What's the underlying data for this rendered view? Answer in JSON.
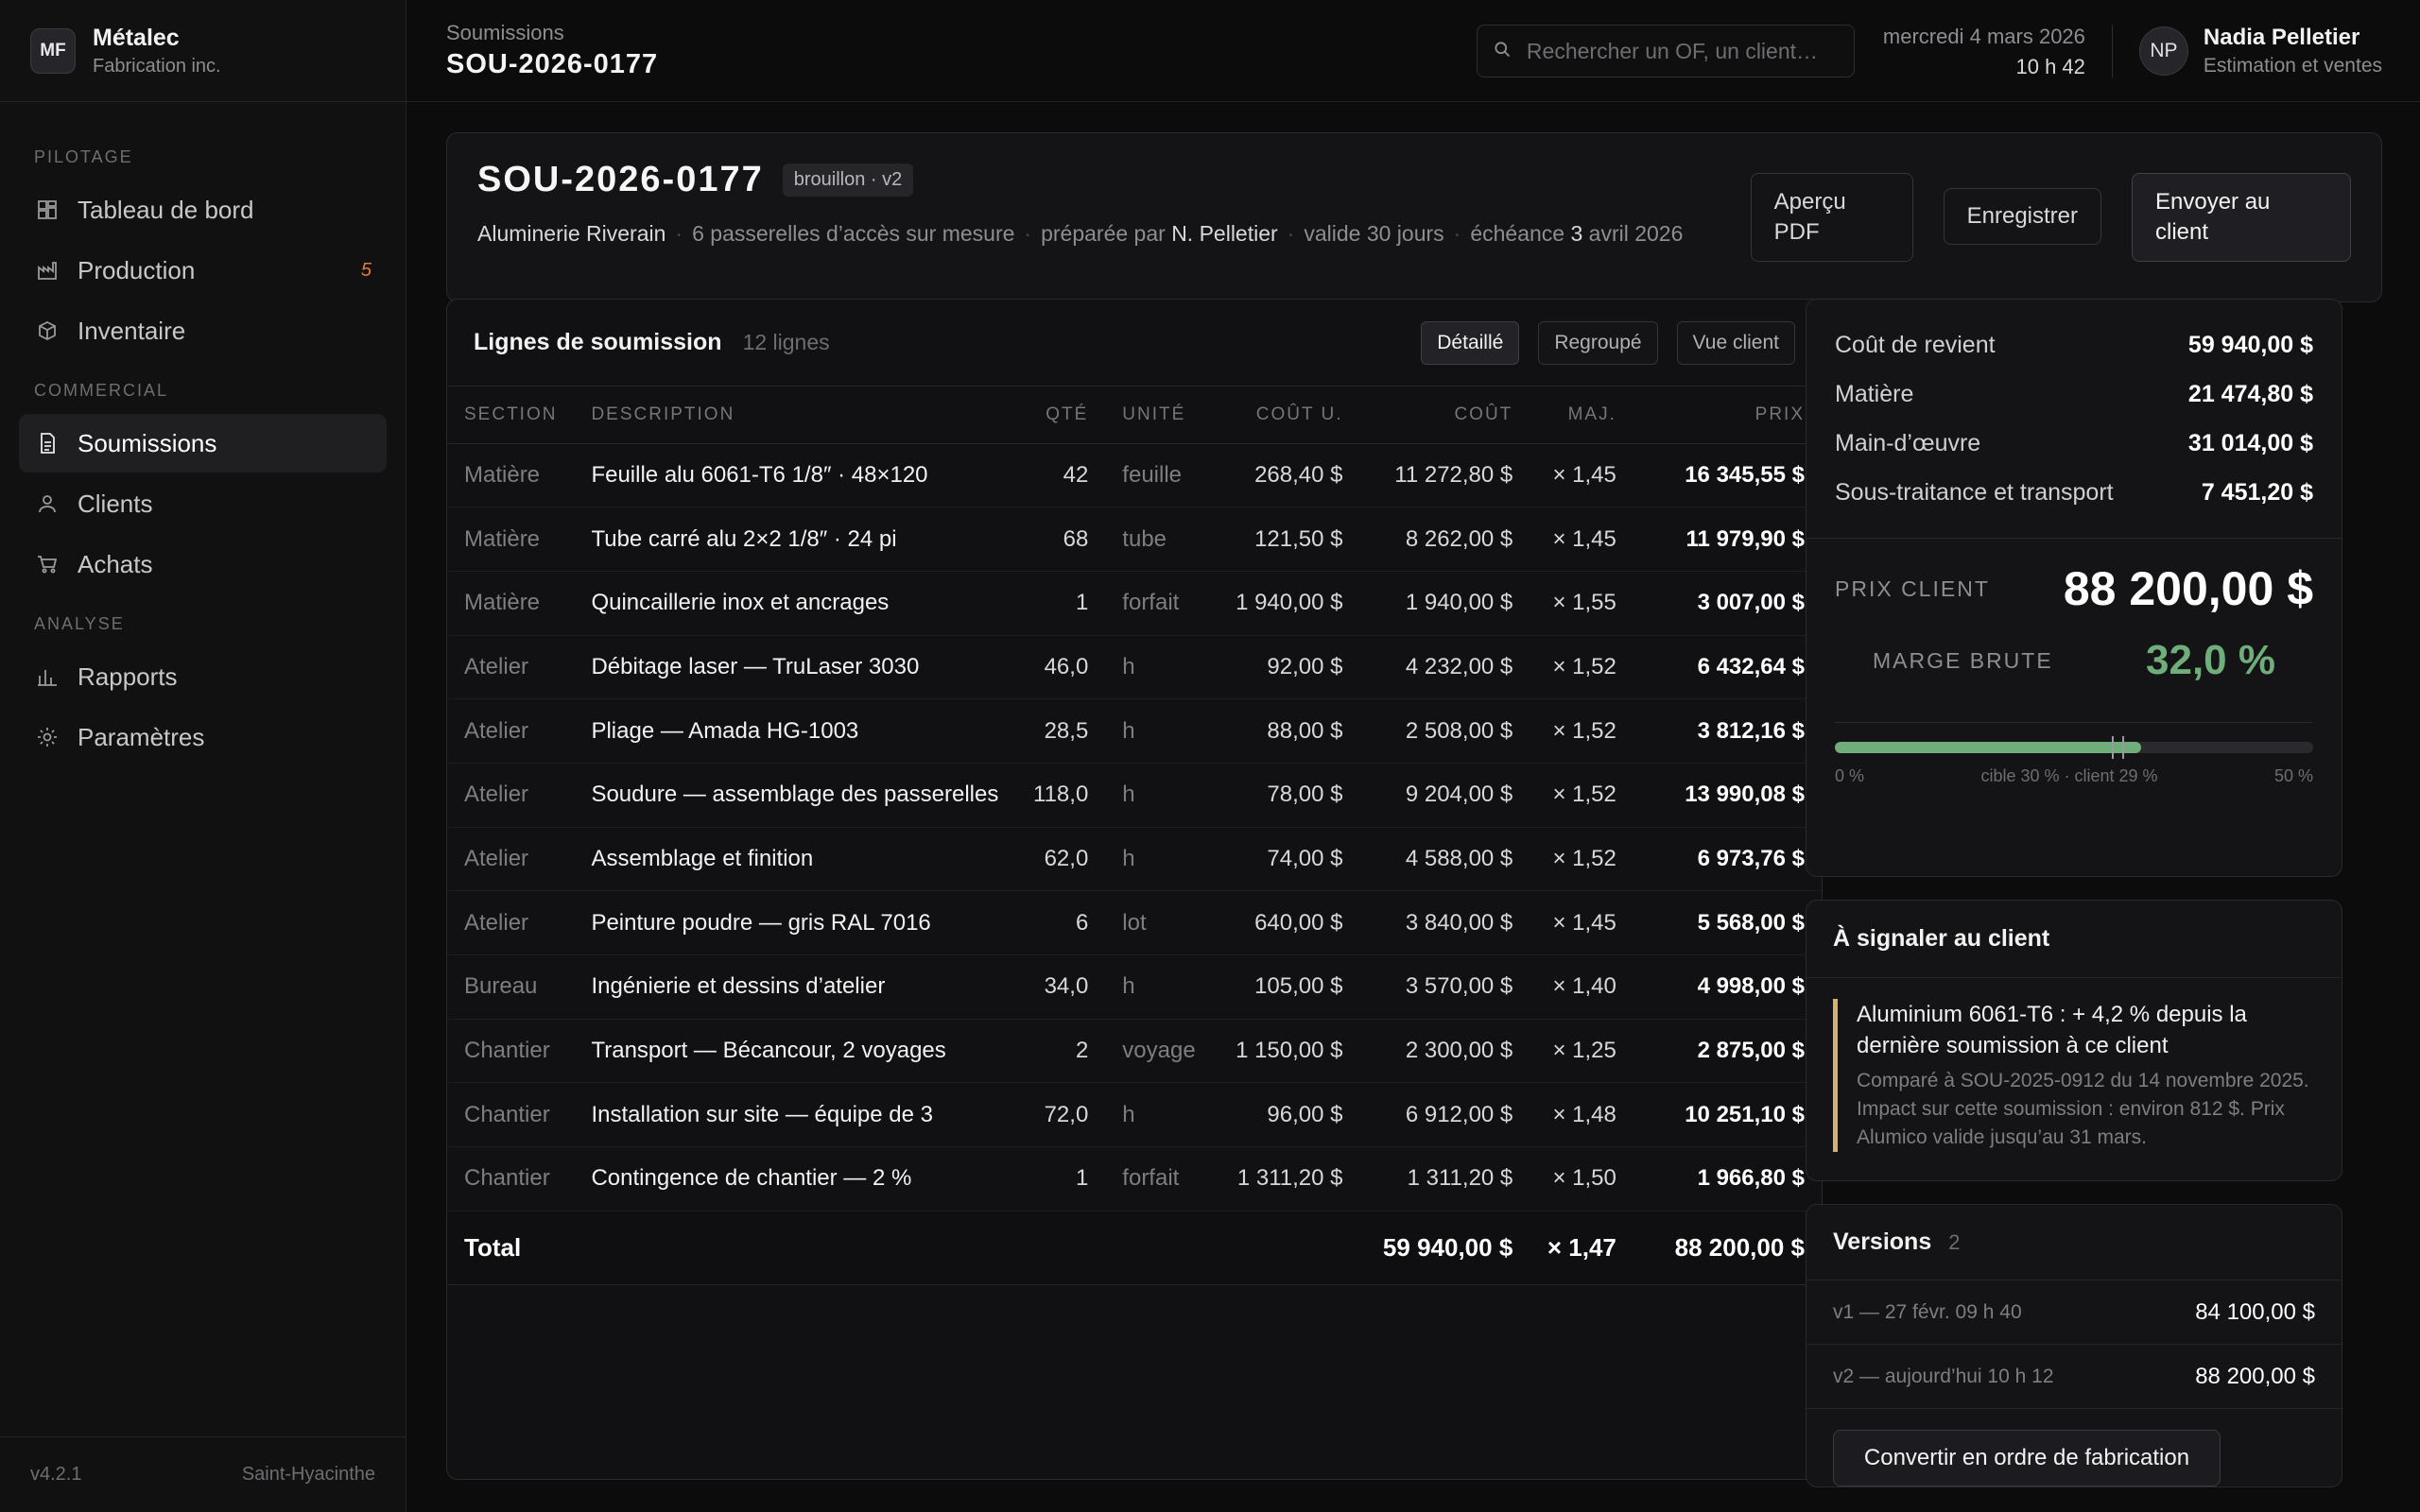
{
  "brand": {
    "initials": "MF",
    "name": "Métalec",
    "sub": "Fabrication inc."
  },
  "nav": {
    "sections": [
      {
        "title": "PILOTAGE",
        "items": [
          {
            "label": "Tableau de bord",
            "icon": "dashboard-icon"
          },
          {
            "label": "Production",
            "icon": "factory-icon",
            "badge": "5"
          },
          {
            "label": "Inventaire",
            "icon": "box-icon"
          }
        ]
      },
      {
        "title": "COMMERCIAL",
        "items": [
          {
            "label": "Soumissions",
            "icon": "document-icon",
            "active": true
          },
          {
            "label": "Clients",
            "icon": "user-icon"
          },
          {
            "label": "Achats",
            "icon": "cart-icon"
          }
        ]
      },
      {
        "title": "ANALYSE",
        "items": [
          {
            "label": "Rapports",
            "icon": "bar-chart-icon"
          },
          {
            "label": "Paramètres",
            "icon": "gear-icon"
          }
        ]
      }
    ],
    "version": "v4.2.1",
    "location": "Saint-Hyacinthe"
  },
  "topbar": {
    "crumb": "Soumissions",
    "title": "SOU-2026-0177",
    "search_placeholder": "Rechercher un OF, un client…",
    "date": "mercredi 4 mars 2026",
    "time": "10 h 42",
    "user_initials": "NP",
    "user_name": "Nadia Pelletier",
    "user_role": "Estimation et ventes"
  },
  "quote": {
    "id": "SOU-2026-0177",
    "status": "brouillon · v2",
    "client": "Aluminerie Riverain",
    "description": "6 passerelles d’accès sur mesure",
    "prepared_prefix": "préparée par",
    "prepared_by": "N. Pelletier",
    "validity": "valide 30 jours",
    "due_prefix": "échéance",
    "due_num": "3",
    "due_rest": "avril 2026",
    "btn_preview": "Aperçu PDF",
    "btn_save": "Enregistrer",
    "btn_send": "Envoyer au client"
  },
  "lines": {
    "title": "Lignes de soumission",
    "count": "12 lignes",
    "views": [
      "Détaillé",
      "Regroupé",
      "Vue client"
    ],
    "headers": [
      "SECTION",
      "DESCRIPTION",
      "QTÉ",
      "UNITÉ",
      "COÛT U.",
      "COÛT",
      "MAJ.",
      "PRIX"
    ],
    "rows": [
      [
        "Matière",
        "Feuille alu 6061-T6 1/8″ · 48×120",
        "42",
        "feuille",
        "268,40 $",
        "11 272,80 $",
        "× 1,45",
        "16 345,55 $"
      ],
      [
        "Matière",
        "Tube carré alu 2×2 1/8″ · 24 pi",
        "68",
        "tube",
        "121,50 $",
        "8 262,00 $",
        "× 1,45",
        "11 979,90 $"
      ],
      [
        "Matière",
        "Quincaillerie inox et ancrages",
        "1",
        "forfait",
        "1 940,00 $",
        "1 940,00 $",
        "× 1,55",
        "3 007,00 $"
      ],
      [
        "Atelier",
        "Débitage laser — TruLaser 3030",
        "46,0",
        "h",
        "92,00 $",
        "4 232,00 $",
        "× 1,52",
        "6 432,64 $"
      ],
      [
        "Atelier",
        "Pliage — Amada HG-1003",
        "28,5",
        "h",
        "88,00 $",
        "2 508,00 $",
        "× 1,52",
        "3 812,16 $"
      ],
      [
        "Atelier",
        "Soudure — assemblage des passerelles",
        "118,0",
        "h",
        "78,00 $",
        "9 204,00 $",
        "× 1,52",
        "13 990,08 $"
      ],
      [
        "Atelier",
        "Assemblage et finition",
        "62,0",
        "h",
        "74,00 $",
        "4 588,00 $",
        "× 1,52",
        "6 973,76 $"
      ],
      [
        "Atelier",
        "Peinture poudre — gris RAL 7016",
        "6",
        "lot",
        "640,00 $",
        "3 840,00 $",
        "× 1,45",
        "5 568,00 $"
      ],
      [
        "Bureau",
        "Ingénierie et dessins d’atelier",
        "34,0",
        "h",
        "105,00 $",
        "3 570,00 $",
        "× 1,40",
        "4 998,00 $"
      ],
      [
        "Chantier",
        "Transport — Bécancour, 2 voyages",
        "2",
        "voyage",
        "1 150,00 $",
        "2 300,00 $",
        "× 1,25",
        "2 875,00 $"
      ],
      [
        "Chantier",
        "Installation sur site — équipe de 3",
        "72,0",
        "h",
        "96,00 $",
        "6 912,00 $",
        "× 1,48",
        "10 251,10 $"
      ],
      [
        "Chantier",
        "Contingence de chantier — 2 %",
        "1",
        "forfait",
        "1 311,20 $",
        "1 311,20 $",
        "× 1,50",
        "1 966,80 $"
      ]
    ],
    "total": {
      "label": "Total",
      "cost": "59 940,00 $",
      "markup": "× 1,47",
      "price": "88 200,00 $"
    }
  },
  "summary": {
    "rows": [
      {
        "label": "Coût de revient",
        "value": "59 940,00 $"
      },
      {
        "label": "Matière",
        "value": "21 474,80 $"
      },
      {
        "label": "Main-d’œuvre",
        "value": "31 014,00 $"
      },
      {
        "label": "Sous-traitance et transport",
        "value": "7 451,20 $"
      }
    ],
    "client_label": "PRIX CLIENT",
    "client_value": "88 200,00 $",
    "margin_label": "MARGE BRUTE",
    "margin_value": "32,0 %",
    "gauge": {
      "min": 0,
      "max": 50,
      "value": 32.0,
      "target": 30,
      "client": 29
    },
    "gauge_left": "0 %",
    "gauge_mid": "cible 30 % · client 29 %",
    "gauge_right": "50 %",
    "accent": "#6fae7a"
  },
  "alert": {
    "title": "À signaler au client",
    "main": "Aluminium 6061-T6 : + 4,2 % depuis la dernière soumission à ce client",
    "sub": "Comparé à SOU-2025-0912 du 14 novembre 2025. Impact sur cette soumission : environ 812 $. Prix Alumico valide jusqu’au 31 mars.",
    "color": "#d6b06c"
  },
  "versions": {
    "title": "Versions",
    "count": "2",
    "items": [
      {
        "label": "v1 — 27 févr. 09 h 40",
        "value": "84 100,00 $"
      },
      {
        "label": "v2 — aujourd’hui 10 h 12",
        "value": "88 200,00 $"
      }
    ],
    "convert": "Convertir en ordre de fabrication"
  }
}
